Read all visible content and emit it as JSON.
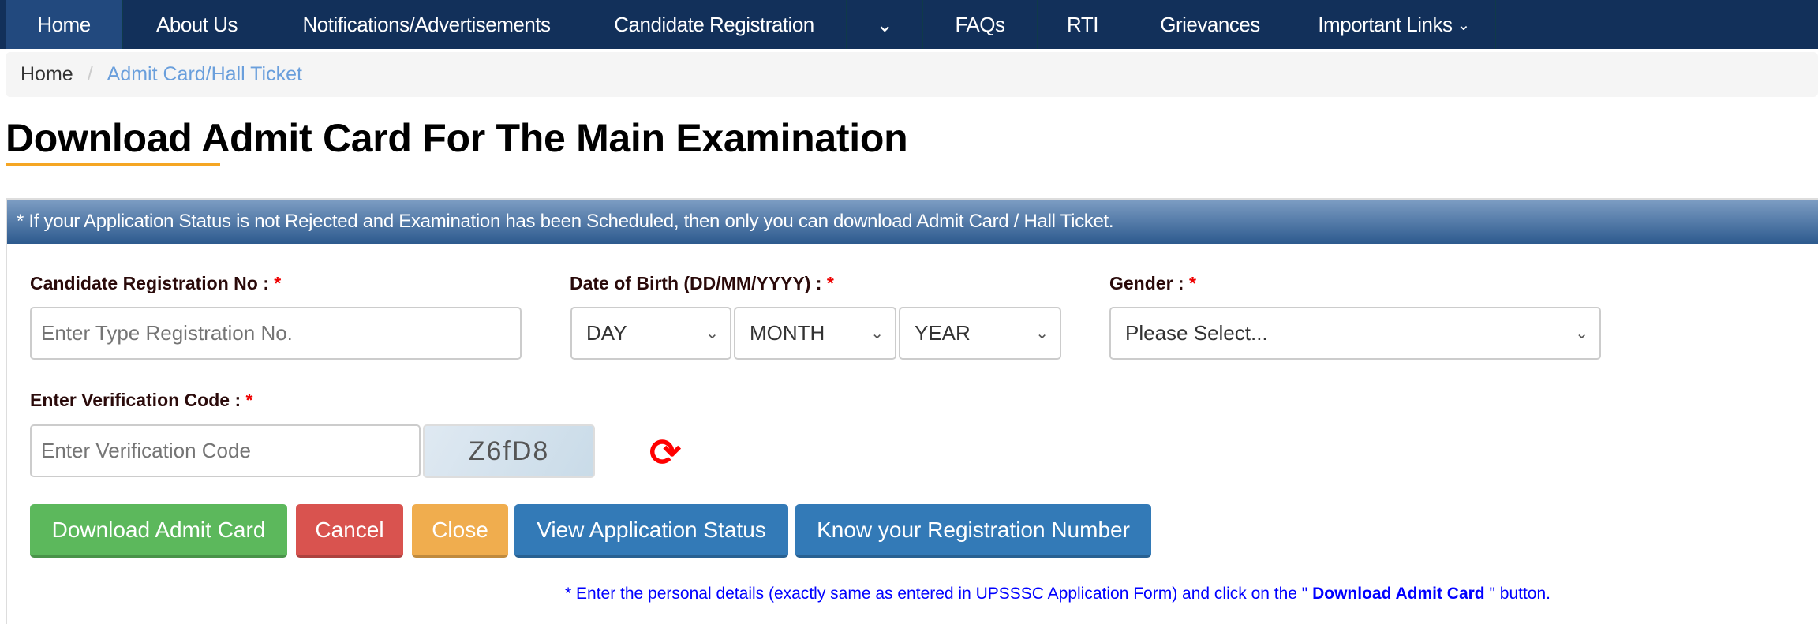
{
  "nav": {
    "items": [
      "Home",
      "About Us",
      "Notifications/Advertisements",
      "Candidate Registration",
      "FAQs",
      "RTI",
      "Grievances",
      "Important Links"
    ]
  },
  "breadcrumb": {
    "home": "Home",
    "current": "Admit Card/Hall Ticket"
  },
  "page_title": "Download Admit Card For The Main Examination",
  "info": "* If your Application Status is not Rejected and Examination has been Scheduled, then only you can download Admit Card / Hall Ticket.",
  "form": {
    "reg_label": "Candidate Registration No :",
    "reg_placeholder": "Enter Type Registration No.",
    "dob_label": "Date of Birth (DD/MM/YYYY) :",
    "day": "DAY",
    "month": "MONTH",
    "year": "YEAR",
    "gender_label": "Gender :",
    "gender": "Please Select...",
    "code_label": "Enter Verification Code :",
    "code_placeholder": "Enter Verification Code",
    "captcha": "Z6fD8",
    "required": "*"
  },
  "buttons": {
    "download": "Download Admit Card",
    "cancel": "Cancel",
    "close": "Close",
    "status": "View Application Status",
    "know": "Know your Registration Number"
  },
  "note": {
    "pre": "* Enter the personal details (exactly same as entered in UPSSSC Application Form) and click on the \"",
    "bold": " Download Admit Card ",
    "post": "\" button."
  },
  "colors": {
    "nav": "#12305a",
    "green": "#5cb85c",
    "red": "#d9534f",
    "orange": "#f0ad4e",
    "blue": "#337ab7"
  }
}
